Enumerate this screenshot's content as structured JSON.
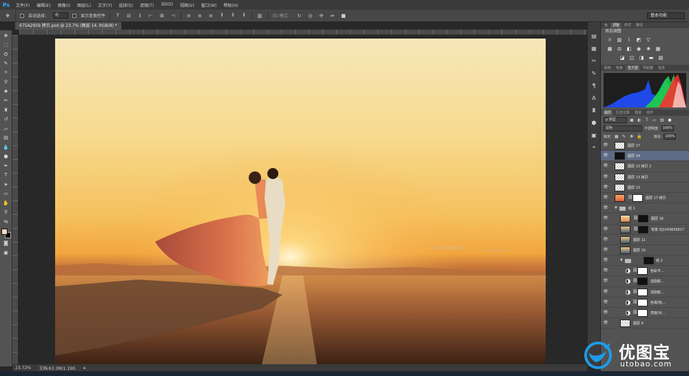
{
  "app": {
    "logo": "Ps"
  },
  "menu": [
    "文件(F)",
    "编辑(E)",
    "图像(I)",
    "图层(L)",
    "文字(Y)",
    "选择(S)",
    "滤镜(T)",
    "3D(D)",
    "视图(V)",
    "窗口(W)",
    "帮助(H)"
  ],
  "options": {
    "auto_select_label": "自动选择：",
    "auto_select_value": "组",
    "show_transform_label": "显示变换控件",
    "mode_3d_label": "3D 模式：",
    "workspace": "基本功能"
  },
  "document": {
    "tab_title": "675A2959 拷贝.psd @ 23.7% (图层 14, RGB/8) *"
  },
  "status": {
    "zoom": "23.72%",
    "doc_size": "文档:63.3M/1.19G"
  },
  "panels": {
    "top_tabs": [
      "色",
      "调整",
      "样式",
      "路径"
    ],
    "adjust_title": "添加调整",
    "histogram_tabs": [
      "颜色",
      "色板",
      "直方图",
      "导航器",
      "信息"
    ],
    "layer_tabs": [
      "图层",
      "历史记录",
      "通道",
      "动作"
    ],
    "filter_kind": "ρ 类型",
    "blend_mode": "滤色",
    "opacity_label": "不透明度:",
    "opacity_value": "100%",
    "lock_label": "锁定:",
    "fill_label": "填充:",
    "fill_value": "100%"
  },
  "layers": [
    {
      "name": "图层 17",
      "thumb": "trans",
      "selected": false,
      "indent": 0,
      "type": "layer"
    },
    {
      "name": "图层 14",
      "thumb": "dark",
      "selected": true,
      "indent": 0,
      "type": "layer"
    },
    {
      "name": "图层 13 拷贝 2",
      "thumb": "trans",
      "selected": false,
      "indent": 0,
      "type": "layer"
    },
    {
      "name": "图层 13 拷贝",
      "thumb": "trans",
      "selected": false,
      "indent": 0,
      "type": "layer"
    },
    {
      "name": "图层 13",
      "thumb": "trans",
      "selected": false,
      "indent": 0,
      "type": "layer"
    },
    {
      "name": "图层 17 拷贝",
      "thumb": "orange",
      "selected": false,
      "indent": 0,
      "type": "masked"
    },
    {
      "name": "组 1",
      "thumb": "",
      "selected": false,
      "indent": 0,
      "type": "group"
    },
    {
      "name": "图层 16",
      "thumb": "photo1",
      "selected": false,
      "indent": 1,
      "type": "masked"
    },
    {
      "name": "背景 QQ240836817",
      "thumb": "sunset",
      "selected": false,
      "indent": 1,
      "type": "masked"
    },
    {
      "name": "图层 11",
      "thumb": "sunset",
      "selected": false,
      "indent": 1,
      "type": "layer"
    },
    {
      "name": "图层 10",
      "thumb": "sunset",
      "selected": false,
      "indent": 1,
      "type": "layer"
    },
    {
      "name": "组 2",
      "thumb": "",
      "selected": false,
      "indent": 1,
      "type": "group"
    },
    {
      "name": "色彩平...",
      "thumb": "white",
      "selected": false,
      "indent": 2,
      "type": "adjust"
    },
    {
      "name": "选取颜...",
      "thumb": "dark",
      "selected": false,
      "indent": 2,
      "type": "adjust"
    },
    {
      "name": "选取颜...",
      "thumb": "white",
      "selected": false,
      "indent": 2,
      "type": "adjust"
    },
    {
      "name": "色相/饱...",
      "thumb": "white",
      "selected": false,
      "indent": 2,
      "type": "adjust"
    },
    {
      "name": "亮度/对...",
      "thumb": "white",
      "selected": false,
      "indent": 2,
      "type": "adjust"
    },
    {
      "name": "图层 9",
      "thumb": "trans",
      "selected": false,
      "indent": 1,
      "type": "layer"
    }
  ],
  "watermark": {
    "title": "优图宝",
    "url": "utobao.com"
  },
  "colors": {
    "accent": "#31a8ff",
    "panel": "#535353",
    "selected": "#5d6b85"
  }
}
